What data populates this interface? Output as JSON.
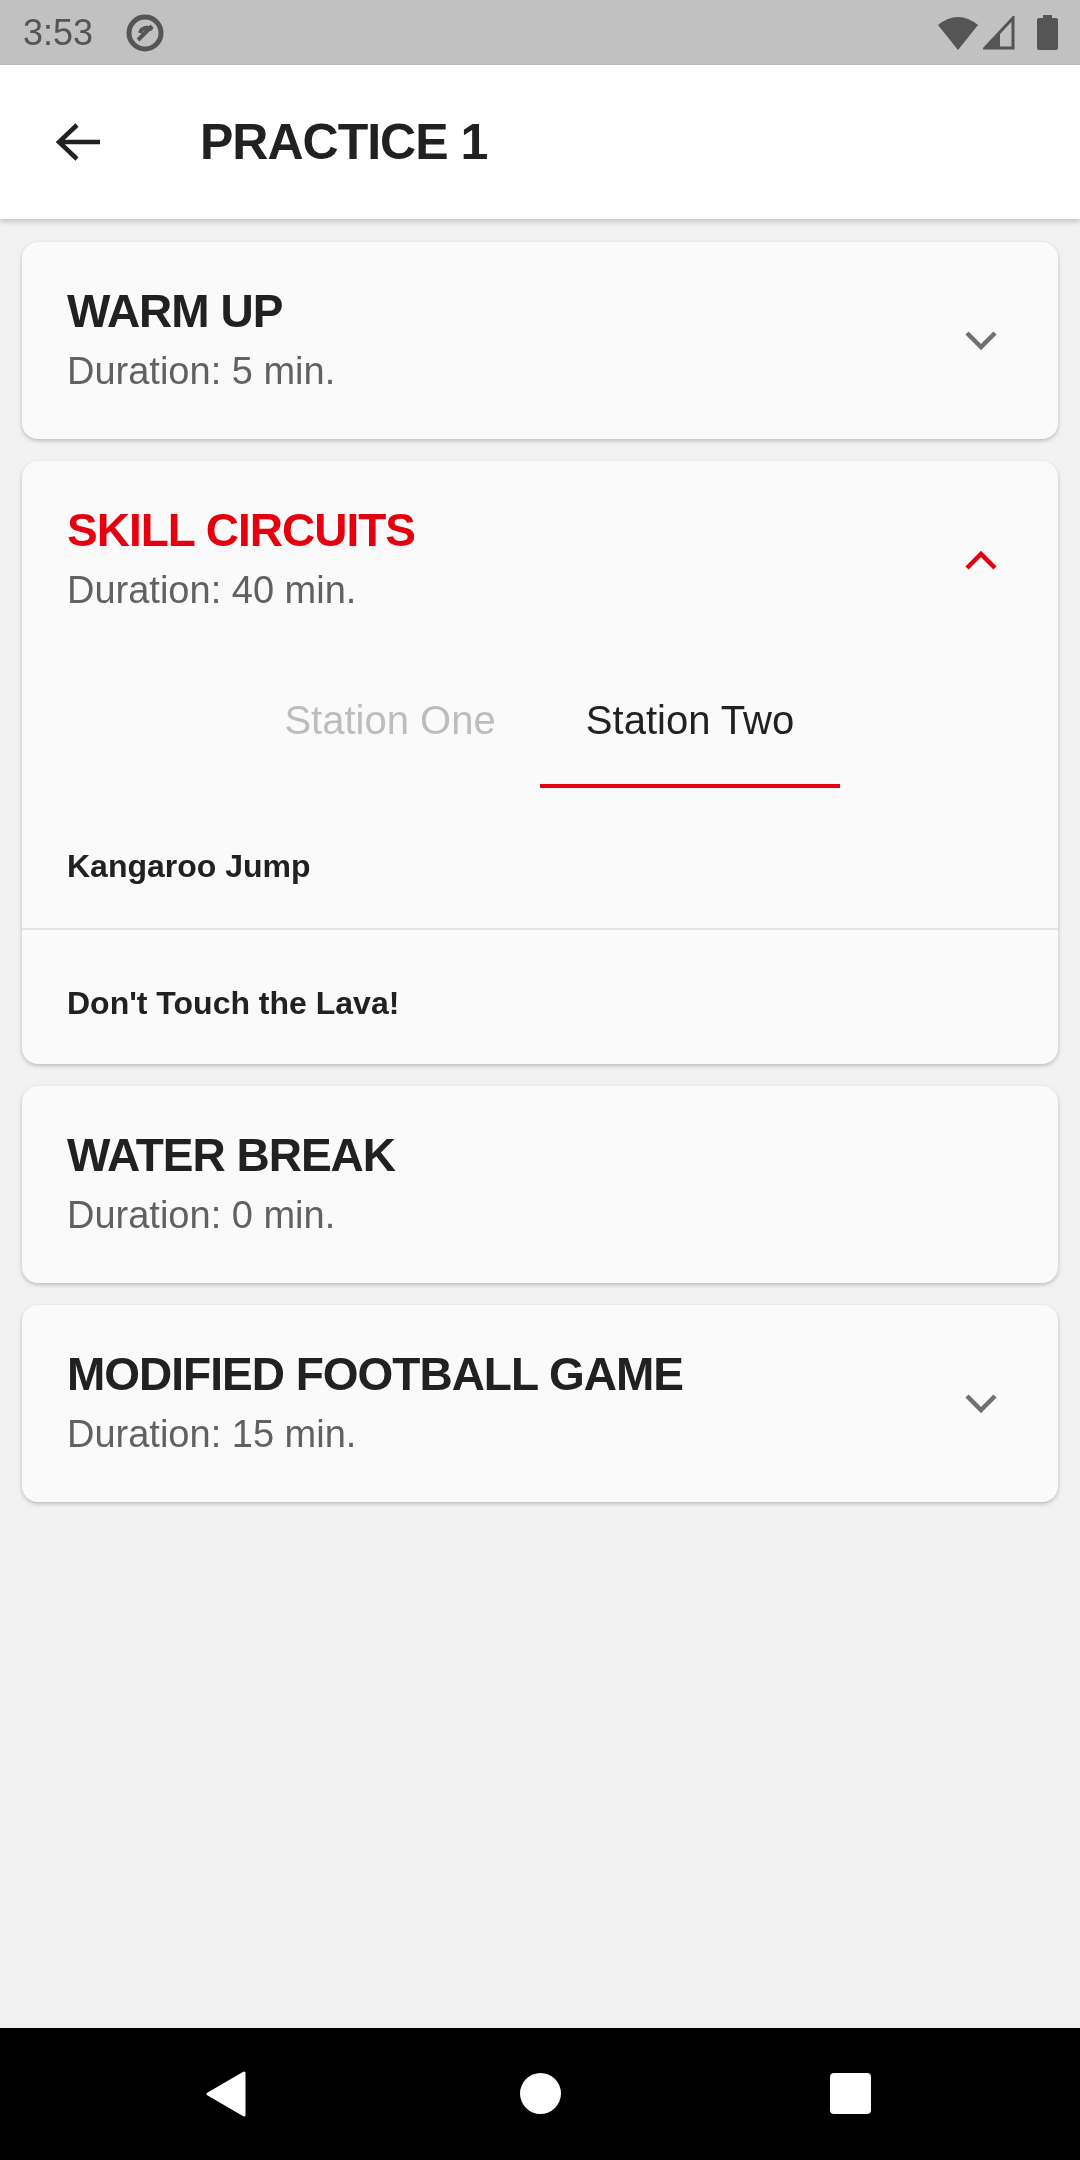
{
  "status_bar": {
    "time": "3:53"
  },
  "app_bar": {
    "title": "PRACTICE 1"
  },
  "sections": [
    {
      "title": "WARM UP",
      "duration": "Duration: 5 min.",
      "expandable": true,
      "expanded": false
    },
    {
      "title": "SKILL CIRCUITS",
      "duration": "Duration: 40 min.",
      "expandable": true,
      "expanded": true,
      "tabs": [
        {
          "label": "Station One",
          "selected": false
        },
        {
          "label": "Station Two",
          "selected": true
        }
      ],
      "activities": [
        "Kangaroo Jump",
        "Don't Touch the Lava!"
      ]
    },
    {
      "title": "WATER BREAK",
      "duration": "Duration: 0 min.",
      "expandable": false,
      "expanded": false
    },
    {
      "title": "MODIFIED FOOTBALL GAME",
      "duration": "Duration: 15 min.",
      "expandable": true,
      "expanded": false
    }
  ]
}
